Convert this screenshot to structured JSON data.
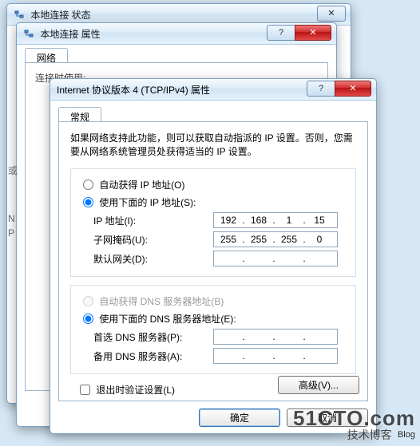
{
  "winA": {
    "title": "本地连接 状态",
    "close_glyph": "✕"
  },
  "winB": {
    "title": "本地连接 属性",
    "help_glyph": "?",
    "close_glyph": "✕",
    "tab_label": "网络",
    "hint_line": "连接时使用:"
  },
  "side_labels": {
    "a": "或",
    "b": "N P"
  },
  "winC": {
    "title": "Internet 协议版本 4 (TCP/IPv4) 属性",
    "help_glyph": "?",
    "close_glyph": "✕",
    "tab_label": "常规",
    "description": "如果网络支持此功能，则可以获取自动指派的 IP 设置。否则，您需要从网络系统管理员处获得适当的 IP 设置。",
    "ip_group": {
      "radio_auto": "自动获得 IP 地址(O)",
      "radio_manual": "使用下面的 IP 地址(S):",
      "selected": "manual",
      "fields": {
        "ip_label": "IP 地址(I):",
        "ip": [
          "192",
          "168",
          "1",
          "15"
        ],
        "mask_label": "子网掩码(U):",
        "mask": [
          "255",
          "255",
          "255",
          "0"
        ],
        "gw_label": "默认网关(D):",
        "gw": [
          "",
          "",
          "",
          ""
        ]
      }
    },
    "dns_group": {
      "radio_auto": "自动获得 DNS 服务器地址(B)",
      "radio_manual": "使用下面的 DNS 服务器地址(E):",
      "selected": "manual",
      "auto_disabled": true,
      "fields": {
        "pref_label": "首选 DNS 服务器(P):",
        "pref": [
          "",
          "",
          "",
          ""
        ],
        "alt_label": "备用 DNS 服务器(A):",
        "alt": [
          "",
          "",
          "",
          ""
        ]
      }
    },
    "validate_label": "退出时验证设置(L)",
    "validate_checked": false,
    "advanced_label": "高级(V)...",
    "ok_label": "确定",
    "cancel_label": "取消"
  },
  "watermark": {
    "line1": "51CTO.com",
    "line2": "技术博客",
    "tag": "Blog"
  }
}
